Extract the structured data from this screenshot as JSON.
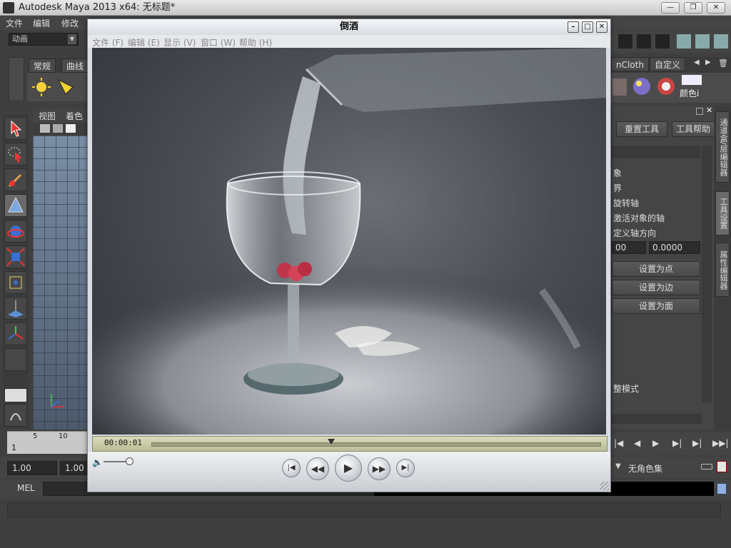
{
  "maya": {
    "title": "Autodesk Maya 2013 x64: 无标题*",
    "window_buttons": [
      "—",
      "❐",
      "✕"
    ],
    "menu": [
      "文件",
      "编辑",
      "修改"
    ],
    "mode": "动画",
    "shelf_tabs": [
      "常规",
      "曲线"
    ],
    "right_shelf_tabs": [
      "nCloth",
      "自定义"
    ],
    "right_shelf_color_label": "颜色i",
    "viewport_menu": [
      "视图",
      "着色"
    ],
    "timeline": {
      "ticks": [
        "5",
        "10"
      ],
      "start_frame": "1"
    },
    "range": {
      "start": "1.00",
      "start2": "1.00"
    },
    "tool_settings": {
      "reset_tool": "重置工具",
      "tool_help": "工具帮助",
      "lines": [
        "象",
        "界",
        "旋转轴",
        "激活对象的轴",
        "定义轴方向"
      ],
      "field1": "00",
      "field2": "0.0000",
      "set_point": "设置为点",
      "set_edge": "设置为边",
      "set_face": "设置为面",
      "adjust_mode": "整模式"
    },
    "side_tabs": [
      "通道盒/层编辑器",
      "工具设置",
      "属性编辑器"
    ],
    "character_set": "无角色集",
    "mel_label": "MEL"
  },
  "player": {
    "title": "倒酒",
    "menu": [
      "文件 (F)",
      "编辑 (E)",
      "显示 (V)",
      "窗口 (W)",
      "帮助 (H)"
    ],
    "timecode": "00:00:01",
    "progress": 0.4,
    "volume": 0.9
  },
  "colors": {
    "maya_bg": "#3f3f3f",
    "player_chrome": "#d9dde2",
    "seekbar": "#c9cca8"
  }
}
